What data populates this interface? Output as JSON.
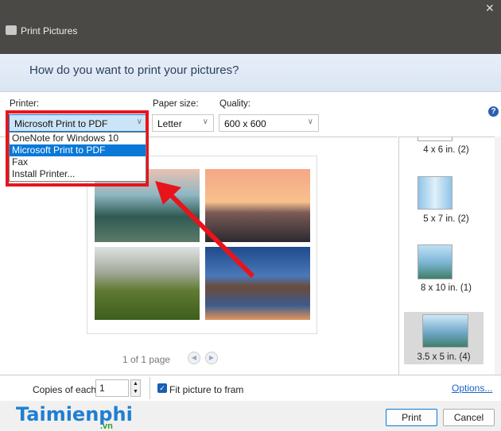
{
  "window": {
    "title": "Print Pictures",
    "close": "✕"
  },
  "header": {
    "question": "How do you want to print your pictures?"
  },
  "options": {
    "printer_label": "Printer:",
    "printer_value": "Microsoft Print to PDF",
    "paper_label": "Paper size:",
    "paper_value": "Letter",
    "quality_label": "Quality:",
    "quality_value": "600 x 600",
    "help": "?"
  },
  "printer_options": [
    "OneNote for Windows 10",
    "Microsoft Print to PDF",
    "Fax",
    "Install Printer..."
  ],
  "preview": {
    "page_info": "1 of 1 page"
  },
  "layouts": [
    {
      "label": "4 x 6 in. (2)"
    },
    {
      "label": "5 x 7 in. (2)"
    },
    {
      "label": "8 x 10 in. (1)"
    },
    {
      "label": "3.5 x 5 in. (4)"
    }
  ],
  "bottom": {
    "copies_label": "Copies of each",
    "copies_value": "1",
    "fit_label": "Fit picture to fram",
    "fit_checked": true,
    "options_link": "Options..."
  },
  "footer": {
    "print": "Print",
    "cancel": "Cancel",
    "watermark": "Taimienphi",
    ".vn": ".vn"
  },
  "colors": {
    "highlight": "#0a78d7",
    "annotation": "#e8141b"
  }
}
